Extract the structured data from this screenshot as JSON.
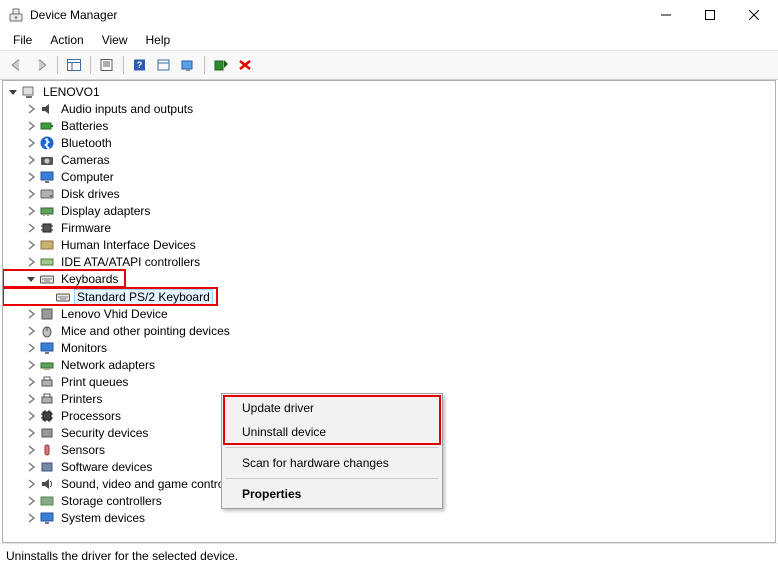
{
  "window": {
    "title": "Device Manager"
  },
  "menu": {
    "file": "File",
    "action": "Action",
    "view": "View",
    "help": "Help"
  },
  "root": {
    "label": "LENOVO1"
  },
  "cats": {
    "audio": "Audio inputs and outputs",
    "batteries": "Batteries",
    "bluetooth": "Bluetooth",
    "cameras": "Cameras",
    "computer": "Computer",
    "disk": "Disk drives",
    "display": "Display adapters",
    "firmware": "Firmware",
    "hid": "Human Interface Devices",
    "ide": "IDE ATA/ATAPI controllers",
    "keyboards": "Keyboards",
    "keyboards_child": "Standard PS/2 Keyboard",
    "lenovo_vhid": "Lenovo Vhid Device",
    "mice": "Mice and other pointing devices",
    "monitors": "Monitors",
    "netadapters": "Network adapters",
    "printqueues": "Print queues",
    "printers": "Printers",
    "processors": "Processors",
    "security": "Security devices",
    "sensors": "Sensors",
    "software": "Software devices",
    "sound": "Sound, video and game controllers",
    "storage": "Storage controllers",
    "system": "System devices"
  },
  "context_menu": {
    "update": "Update driver",
    "uninstall": "Uninstall device",
    "scan": "Scan for hardware changes",
    "properties": "Properties"
  },
  "statusbar": "Uninstalls the driver for the selected device."
}
